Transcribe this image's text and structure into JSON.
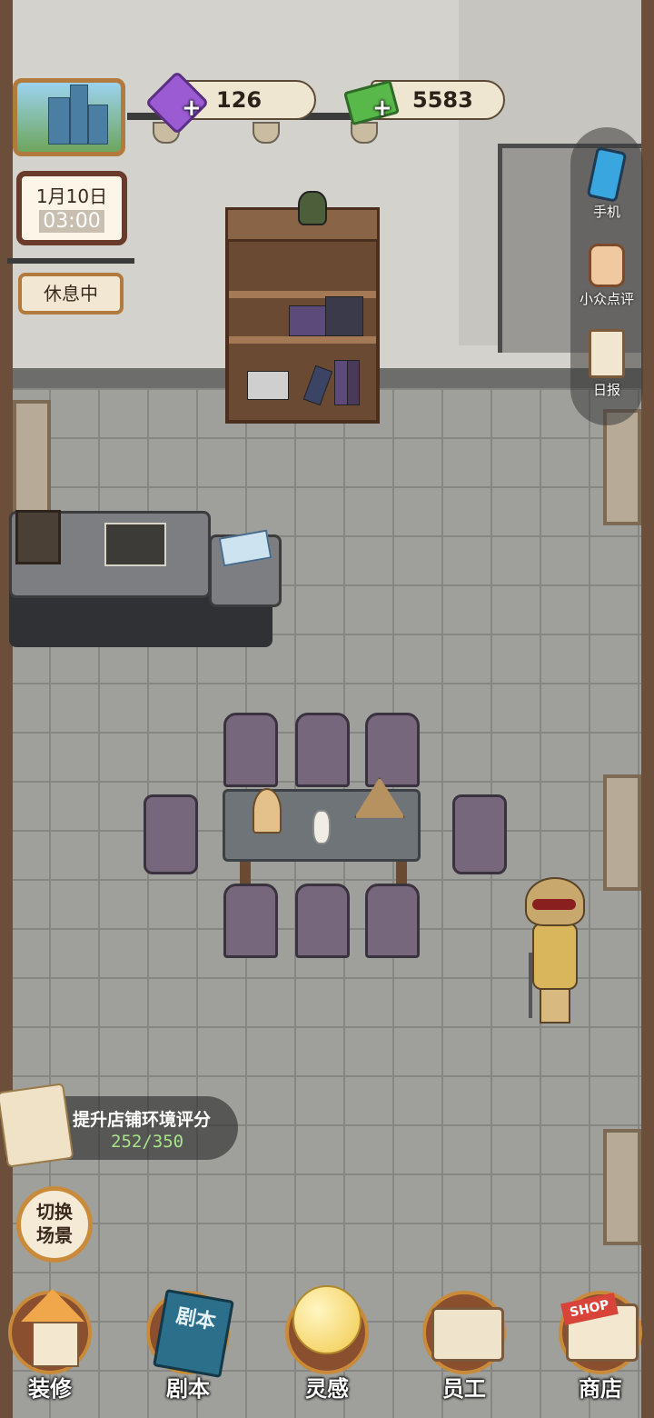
{
  "resources": {
    "gems": "126",
    "cash": "5583"
  },
  "calendar": {
    "date": "1月10日",
    "time": "03:00"
  },
  "shop_status": "休息中",
  "right_menu": {
    "phone": "手机",
    "review": "小众点评",
    "daily": "日报"
  },
  "task": {
    "title": "提升店铺环境评分",
    "progress_text": "252/350",
    "progress_value": 252,
    "progress_max": 350
  },
  "switch_scene": "切换场景",
  "bottom_nav": {
    "decorate": "装修",
    "script": "剧本",
    "inspiration": "灵感",
    "staff": "员工",
    "shop": "商店"
  },
  "icon_labels": {
    "script_book": "剧本",
    "shop_sign": "SHOP"
  },
  "colors": {
    "accent_wood": "#c98a3a",
    "progress_green": "#a7e388",
    "gem_purple": "#9b5bd3",
    "cash_green": "#58b84a"
  },
  "icons": [
    "gem-icon",
    "cash-icon",
    "phone-icon",
    "thumbs-up-icon",
    "clipboard-icon",
    "scroll-icon",
    "house-icon",
    "book-icon",
    "lightbulb-icon",
    "id-card-icon",
    "shop-icon"
  ]
}
